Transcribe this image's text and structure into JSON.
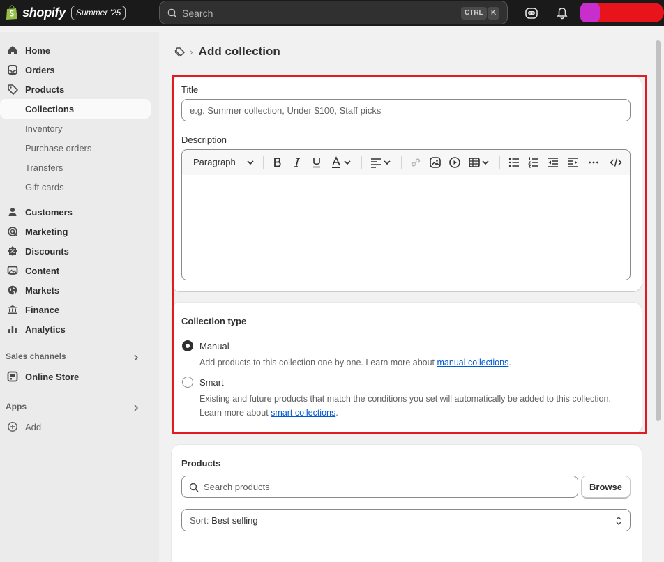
{
  "topbar": {
    "brand": "shopify",
    "season_badge": "Summer '25",
    "search_placeholder": "Search",
    "shortcut_ctrl": "CTRL",
    "shortcut_k": "K"
  },
  "sidebar": {
    "home": "Home",
    "orders": "Orders",
    "products": "Products",
    "collections": "Collections",
    "inventory": "Inventory",
    "purchase_orders": "Purchase orders",
    "transfers": "Transfers",
    "gift_cards": "Gift cards",
    "customers": "Customers",
    "marketing": "Marketing",
    "discounts": "Discounts",
    "content": "Content",
    "markets": "Markets",
    "finance": "Finance",
    "analytics": "Analytics",
    "sales_channels": "Sales channels",
    "online_store": "Online Store",
    "apps": "Apps",
    "add": "Add"
  },
  "page": {
    "title": "Add collection"
  },
  "details_card": {
    "title_label": "Title",
    "title_placeholder": "e.g. Summer collection, Under $100, Staff picks",
    "description_label": "Description",
    "paragraph_style": "Paragraph"
  },
  "collection_type": {
    "heading": "Collection type",
    "manual_label": "Manual",
    "manual_help": "Add products to this collection one by one. Learn more about ",
    "manual_link": "manual collections",
    "smart_label": "Smart",
    "smart_help_line1": "Existing and future products that match the conditions you set will automatically be added to this collection.",
    "smart_help_line2": "Learn more about ",
    "smart_link": "smart collections",
    "period": ".",
    "selected": "Manual"
  },
  "products_card": {
    "heading": "Products",
    "search_placeholder": "Search products",
    "browse_label": "Browse",
    "sort_prefix": "Sort: ",
    "sort_value": "Best selling"
  },
  "colors": {
    "topbar_bg": "#1a1a1a",
    "highlight_border": "#e11b22",
    "link": "#005bd3"
  }
}
